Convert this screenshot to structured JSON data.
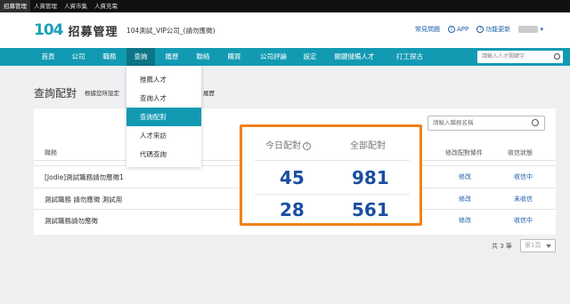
{
  "topbar": [
    "招募管理",
    "人資管理",
    "人資市集",
    "人資充電"
  ],
  "header": {
    "logo_num": "104",
    "logo_text": "招募管理",
    "company": "104測試_VIP公司_(請勿應徵)",
    "links": [
      "常見問題",
      "APP",
      "功能更新"
    ]
  },
  "nav": {
    "items": [
      "首頁",
      "公司",
      "職務",
      "查詢",
      "履歷",
      "聯絡",
      "購買",
      "公司評論",
      "設定",
      "關鍵儲備人才",
      "打工探古"
    ],
    "active_index": 3,
    "search_placeholder": "請輸入人才關鍵字"
  },
  "dropdown": {
    "items": [
      "推薦人才",
      "查詢人才",
      "查詢配對",
      "人才來訪",
      "代碼查詢"
    ],
    "active_index": 2
  },
  "page": {
    "title": "查詢配對",
    "subtitle_a": "根據您所設定",
    "subtitle_b": "履歷"
  },
  "table": {
    "search_placeholder": "請輸入職務名稱",
    "headers": {
      "job": "職務",
      "edit": "修改配對條件",
      "status": "收信狀態"
    },
    "rows": [
      {
        "name": "[Jodie]測試職務請勿應徵1",
        "edit": "修改",
        "status": "收信中"
      },
      {
        "name": "測試職務 請勿應徵 測試用",
        "edit": "修改",
        "status": "未收信"
      },
      {
        "name": "測試職務請勿應徵",
        "edit": "修改",
        "status": "收信中"
      }
    ]
  },
  "pager": {
    "total": "共 3 筆",
    "page": "第1頁"
  },
  "callout": {
    "today_label": "今日配對",
    "all_label": "全部配對",
    "today_values": [
      "45",
      "28"
    ],
    "all_values": [
      "981",
      "561"
    ]
  },
  "colors": {
    "nav": "#139ab3",
    "highlight": "#f08218",
    "number": "#1a4fa0"
  }
}
